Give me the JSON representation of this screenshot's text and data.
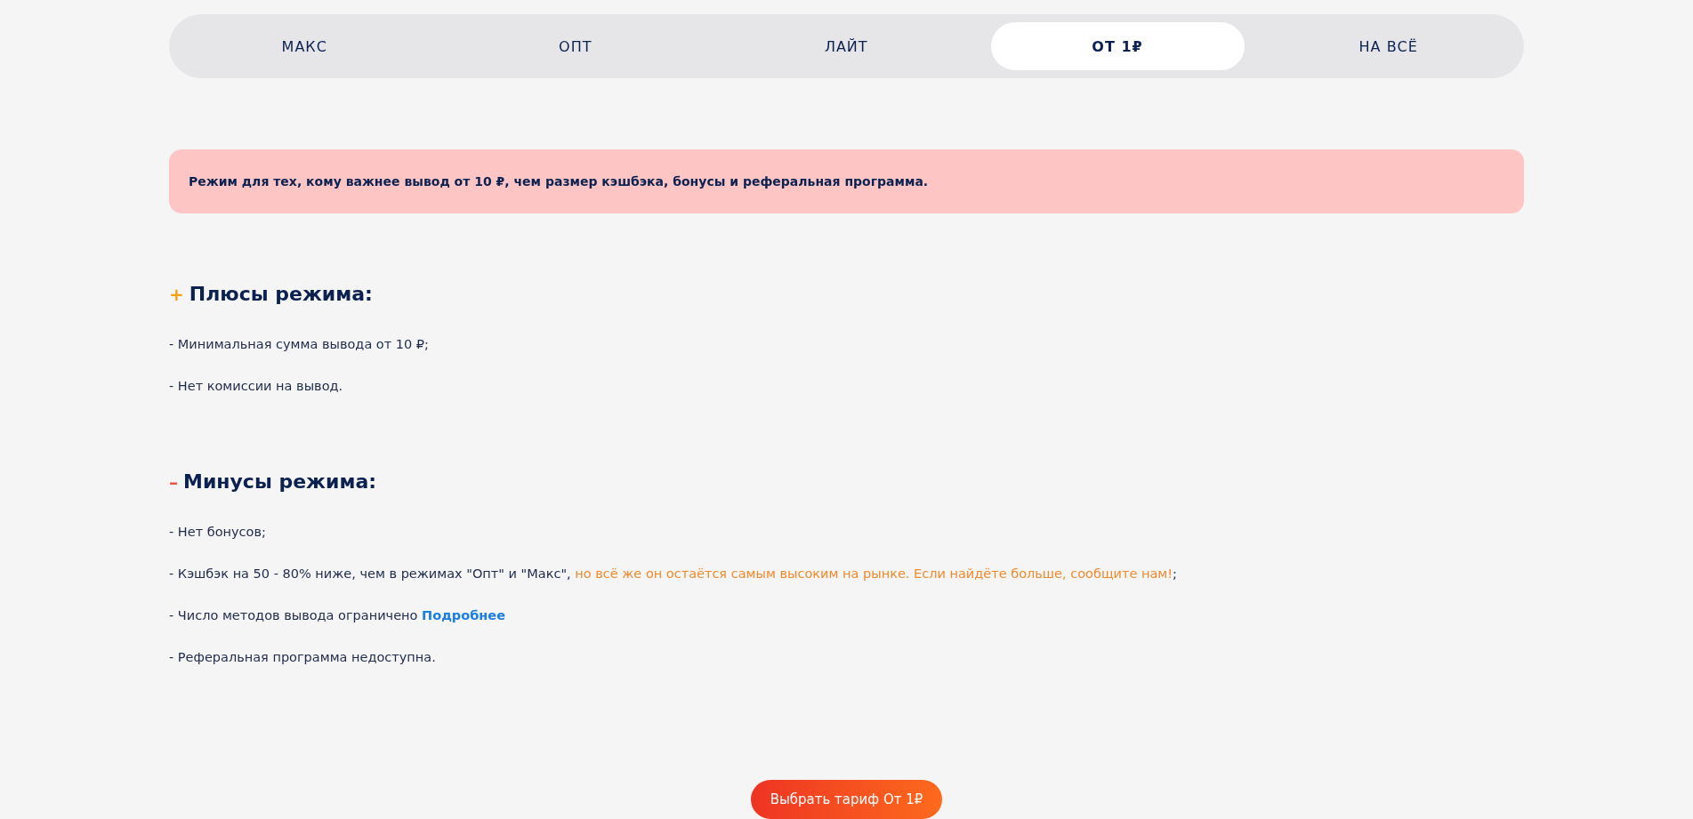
{
  "tabs": [
    {
      "label": "МАКС",
      "selected": false
    },
    {
      "label": "ОПТ",
      "selected": false
    },
    {
      "label": "ЛАЙТ",
      "selected": false
    },
    {
      "label": "ОТ 1₽",
      "selected": true
    },
    {
      "label": "НА ВСЁ",
      "selected": false
    }
  ],
  "notice": "Режим для тех, кому важнее вывод от 10 ₽, чем размер кэшбэка, бонусы и реферальная программа.",
  "sections": [
    {
      "kind": "plus",
      "sign": "+",
      "title": "Плюсы режима:",
      "items": [
        [
          {
            "kind": "plain",
            "text": "- Минимальная сумма вывода от 10 ₽;"
          }
        ],
        [
          {
            "kind": "plain",
            "text": "- Нет комиссии на вывод."
          }
        ]
      ]
    },
    {
      "kind": "minus",
      "sign": "–",
      "title": "Минусы режима:",
      "items": [
        [
          {
            "kind": "plain",
            "text": "- Нет бонусов;"
          }
        ],
        [
          {
            "kind": "plain",
            "text": "- Кэшбэк на 50 - 80% ниже, чем в режимах \"Опт\" и \"Макс\", "
          },
          {
            "kind": "highlight",
            "text": "но всё же он остаётся самым высоким на рынке. Если найдёте больше, сообщите нам!"
          },
          {
            "kind": "plain",
            "text": ";"
          }
        ],
        [
          {
            "kind": "plain",
            "text": "- Число методов вывода ограничено "
          },
          {
            "kind": "link",
            "text": "Подробнее"
          }
        ],
        [
          {
            "kind": "plain",
            "text": "- Реферальная программа недоступна."
          }
        ]
      ]
    }
  ],
  "cta": "Выбрать тариф От 1₽"
}
